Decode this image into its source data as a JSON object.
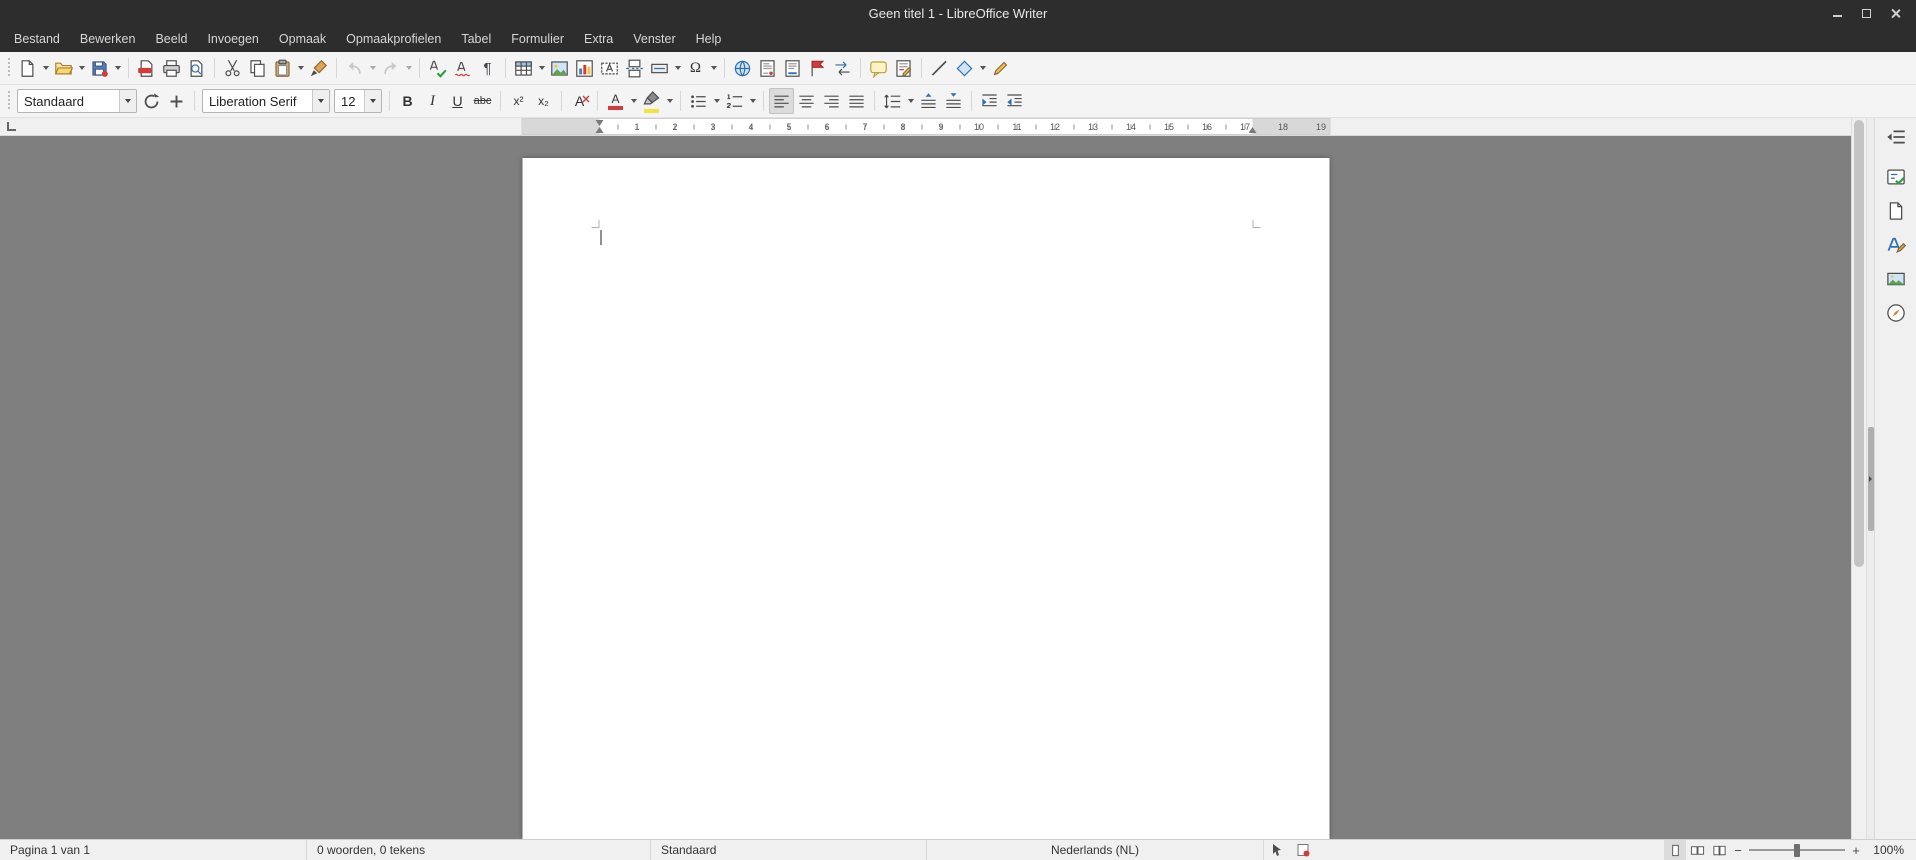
{
  "window": {
    "title": "Geen titel 1 - LibreOffice Writer"
  },
  "menubar": {
    "items": [
      "Bestand",
      "Bewerken",
      "Beeld",
      "Invoegen",
      "Opmaak",
      "Opmaakprofielen",
      "Tabel",
      "Formulier",
      "Extra",
      "Venster",
      "Help"
    ]
  },
  "standard_toolbar": {
    "buttons": [
      "new-document",
      "open",
      "save",
      "export-pdf",
      "print",
      "print-preview",
      "cut",
      "copy",
      "paste",
      "clone-formatting",
      "undo",
      "redo",
      "spelling",
      "automatic-spellcheck",
      "formatting-marks",
      "insert-table",
      "insert-image",
      "insert-chart",
      "insert-text-box",
      "insert-page-break",
      "insert-field",
      "insert-special-character",
      "insert-hyperlink",
      "insert-footnote",
      "insert-endnote",
      "insert-bookmark",
      "insert-cross-reference",
      "insert-comment",
      "track-changes",
      "insert-line",
      "basic-shapes",
      "show-draw-functions"
    ],
    "disabled_buttons": [
      "undo",
      "redo"
    ]
  },
  "formatting_toolbar": {
    "paragraph_style": "Standaard",
    "font_name": "Liberation Serif",
    "font_size": "12",
    "active_buttons": [
      "align-left"
    ],
    "glyphs": {
      "bold": "B",
      "italic": "I",
      "underline": "U",
      "strikethrough": "abc",
      "superscript": "x²",
      "subscript": "x₂",
      "clear_formatting": "A",
      "font_color": "A",
      "special_character": "Ω",
      "formatting_marks": "¶"
    }
  },
  "ruler": {
    "numbers": [
      "1",
      "2",
      "3",
      "4",
      "5",
      "6",
      "7",
      "8",
      "9",
      "10",
      "11",
      "12",
      "13",
      "14",
      "15",
      "16",
      "17",
      "18",
      "19"
    ]
  },
  "sidebar": {
    "tabs": [
      "sidebar-settings",
      "properties",
      "page",
      "styles",
      "gallery",
      "navigator"
    ]
  },
  "statusbar": {
    "page_info": "Pagina 1 van 1",
    "word_count": "0 woorden, 0 tekens",
    "page_style": "Standaard",
    "language": "Nederlands (NL)",
    "zoom_out": "−",
    "zoom_in": "+",
    "zoom_level": "100%"
  },
  "colors": {
    "titlebar_bg": "#2d2d2d",
    "toolbar_bg": "#f4f4f4",
    "canvas_bg": "#7f7f7f",
    "page_bg": "#ffffff",
    "statusbar_bg": "#f0f0f0",
    "accent_red": "#d23c3c",
    "accent_yellow": "#f5c242",
    "accent_blue": "#2f6fb0",
    "accent_green": "#2e9e44"
  }
}
